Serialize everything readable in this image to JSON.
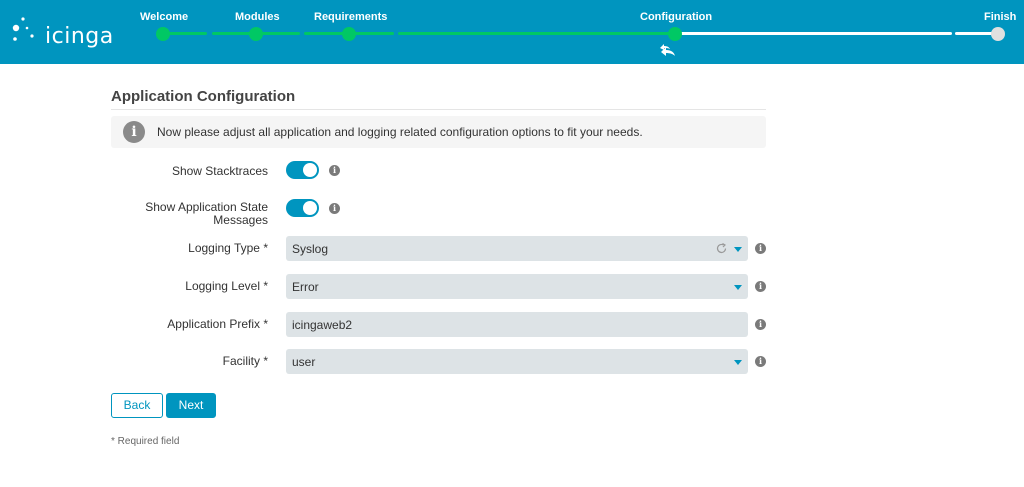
{
  "app": {
    "logo_text": "icinga"
  },
  "wizard": {
    "steps": [
      {
        "label": "Welcome"
      },
      {
        "label": "Modules"
      },
      {
        "label": "Requirements"
      },
      {
        "label": "Configuration"
      },
      {
        "label": "Finish"
      }
    ],
    "current_step": "Configuration"
  },
  "page": {
    "title": "Application Configuration",
    "info": "Now please adjust all application and logging related configuration options to fit your needs."
  },
  "form": {
    "show_stacktraces": {
      "label": "Show Stacktraces",
      "checked": true
    },
    "show_app_state": {
      "label_line1": "Show Application State",
      "label_line2": "Messages",
      "checked": true
    },
    "logging_type": {
      "label": "Logging Type *",
      "value": "Syslog"
    },
    "logging_level": {
      "label": "Logging Level *",
      "value": "Error"
    },
    "app_prefix": {
      "label": "Application Prefix *",
      "value": "icingaweb2"
    },
    "facility": {
      "label": "Facility *",
      "value": "user"
    }
  },
  "buttons": {
    "back": "Back",
    "next": "Next"
  },
  "footer": {
    "required_note": "* Required field"
  },
  "colors": {
    "brand": "#0095bf",
    "progress_done": "#00c864",
    "progress_pending": "#ffffff"
  },
  "icons": {
    "info": "info-icon",
    "help": "help-icon",
    "refresh": "refresh-icon",
    "dropdown": "chevron-down-icon",
    "undo": "undo-icon"
  }
}
